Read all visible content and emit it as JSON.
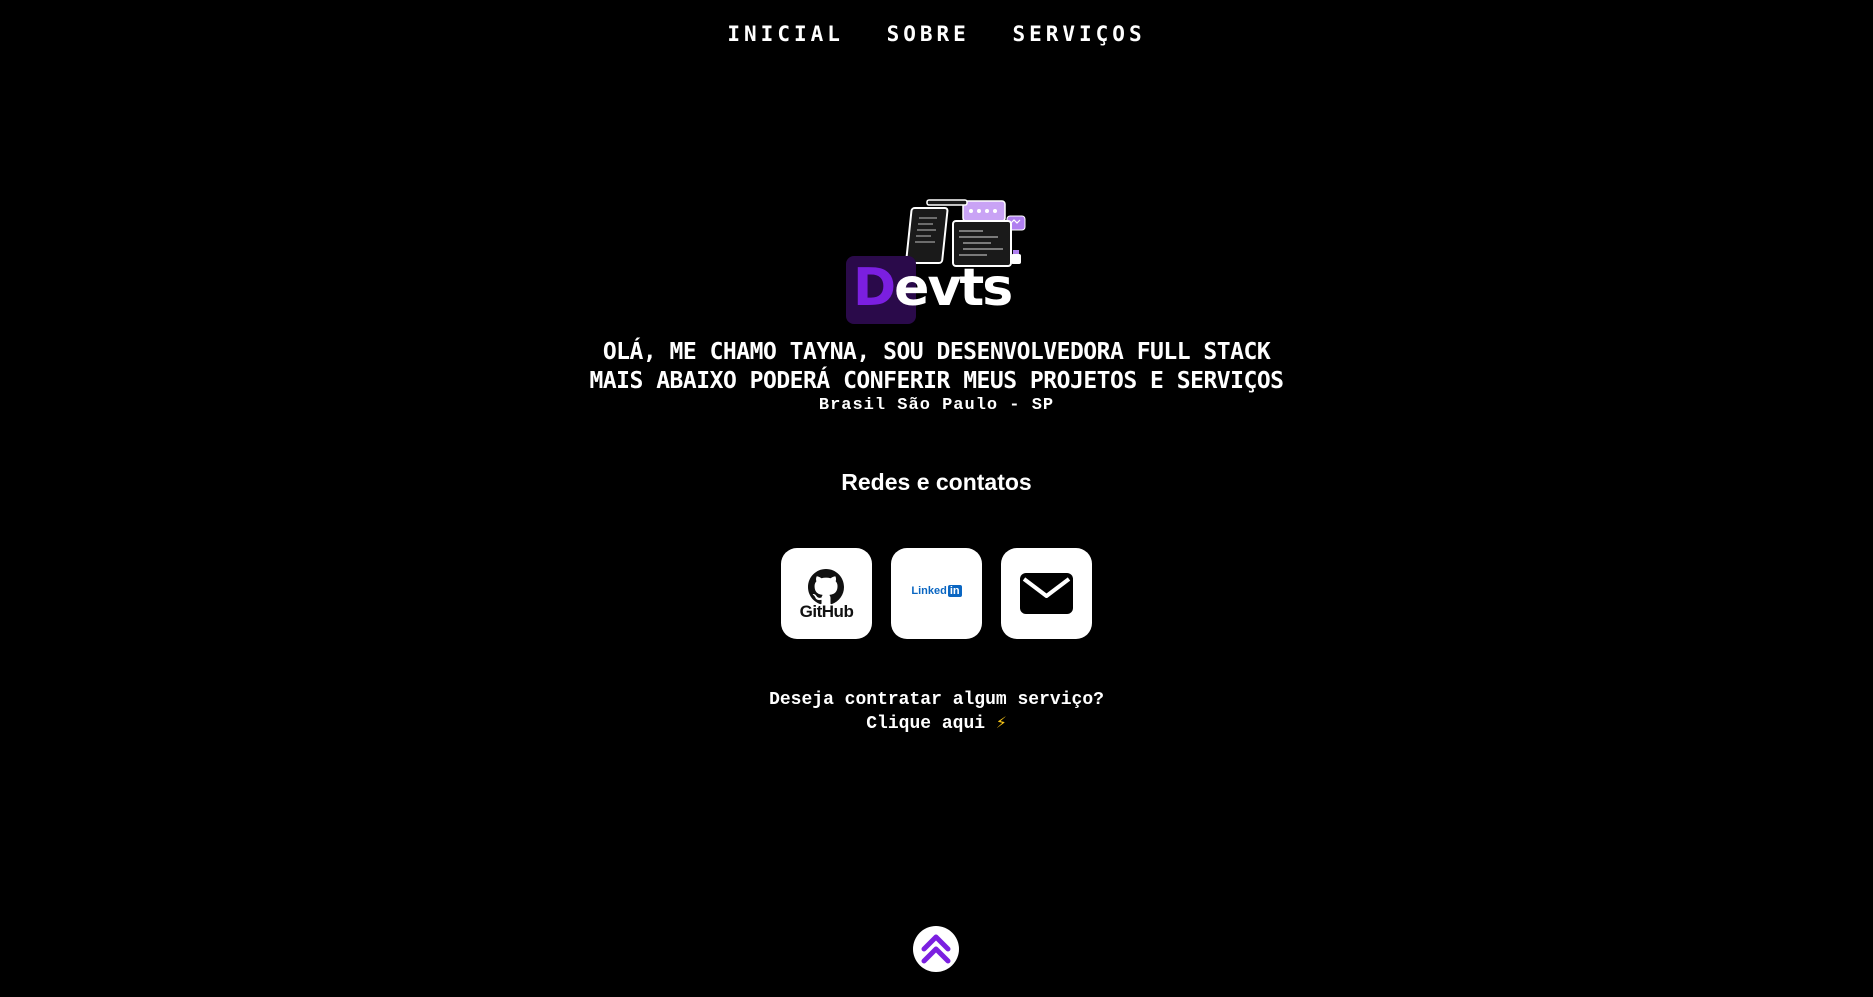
{
  "nav": {
    "items": [
      {
        "label": "INICIAL"
      },
      {
        "label": "SOBRE"
      },
      {
        "label": "SERVIÇOS"
      }
    ]
  },
  "logo": {
    "letter": "D",
    "rest": "evts"
  },
  "hero": {
    "line1": "OLÁ, ME CHAMO TAYNA, SOU DESENVOLVEDORA FULL STACK",
    "line2": "MAIS ABAIXO PODERÁ CONFERIR MEUS PROJETOS E SERVIÇOS",
    "location": "Brasil São Paulo - SP"
  },
  "contacts": {
    "title": "Redes e contatos",
    "github_label": "GitHub",
    "linkedin_label": "Linked",
    "linkedin_badge": "in",
    "icons": [
      "github-icon",
      "linkedin-icon",
      "envelope-icon"
    ]
  },
  "hire": {
    "question": "Deseja contratar algum serviço?",
    "link_text": "Clique aqui",
    "bolt": "⚡"
  },
  "scroll_top": {
    "icon": "double-chevron-up-icon"
  },
  "colors": {
    "background": "#000000",
    "accent": "#7b1fe0",
    "text": "#ffffff",
    "linkedin": "#0a66c2"
  }
}
